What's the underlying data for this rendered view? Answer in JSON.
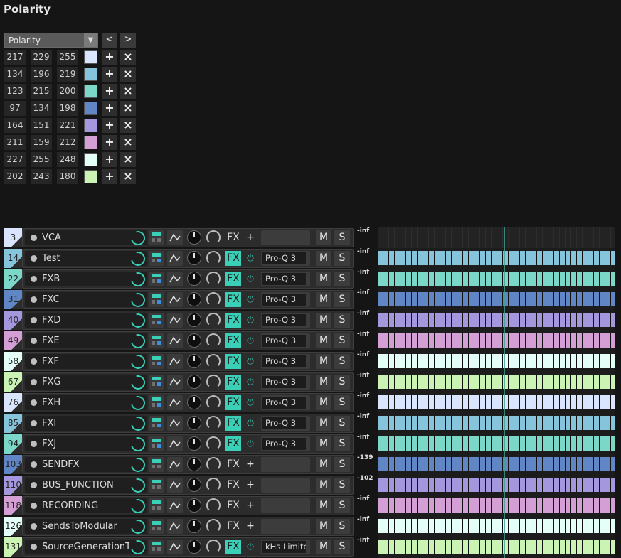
{
  "title": "Polarity",
  "palette": {
    "selected": "Polarity",
    "prev": "<",
    "next": ">",
    "add": "+",
    "remove": "×",
    "rows": [
      {
        "r": "217",
        "g": "229",
        "b": "255",
        "color": "#d9e5ff"
      },
      {
        "r": "134",
        "g": "196",
        "b": "219",
        "color": "#86c4db"
      },
      {
        "r": "123",
        "g": "215",
        "b": "200",
        "color": "#7bd7c8"
      },
      {
        "r": "97",
        "g": "134",
        "b": "198",
        "color": "#6186c6"
      },
      {
        "r": "164",
        "g": "151",
        "b": "221",
        "color": "#a497dd"
      },
      {
        "r": "211",
        "g": "159",
        "b": "212",
        "color": "#d39fd4"
      },
      {
        "r": "227",
        "g": "255",
        "b": "248",
        "color": "#e3fff8"
      },
      {
        "r": "202",
        "g": "243",
        "b": "180",
        "color": "#caf3b4"
      }
    ]
  },
  "tracks": [
    {
      "num": "3",
      "name": "VCA",
      "color": "#d9e5ff",
      "fx_on": false,
      "plugin": "",
      "route_blue": false,
      "meter": "-inf",
      "lane": false
    },
    {
      "num": "14",
      "name": "Test",
      "color": "#86c4db",
      "fx_on": true,
      "plugin": "Pro-Q 3",
      "route_blue": true,
      "meter": "-inf",
      "lane": true
    },
    {
      "num": "22",
      "name": "FXB",
      "color": "#7bd7c8",
      "fx_on": true,
      "plugin": "Pro-Q 3",
      "route_blue": true,
      "meter": "-inf",
      "lane": true
    },
    {
      "num": "31",
      "name": "FXC",
      "color": "#6186c6",
      "fx_on": true,
      "plugin": "Pro-Q 3",
      "route_blue": true,
      "meter": "-inf",
      "lane": true
    },
    {
      "num": "40",
      "name": "FXD",
      "color": "#a497dd",
      "fx_on": true,
      "plugin": "Pro-Q 3",
      "route_blue": true,
      "meter": "-inf",
      "lane": true
    },
    {
      "num": "49",
      "name": "FXE",
      "color": "#d39fd4",
      "fx_on": true,
      "plugin": "Pro-Q 3",
      "route_blue": true,
      "meter": "-inf",
      "lane": true
    },
    {
      "num": "58",
      "name": "FXF",
      "color": "#e3fff8",
      "fx_on": true,
      "plugin": "Pro-Q 3",
      "route_blue": true,
      "meter": "-inf",
      "lane": true
    },
    {
      "num": "67",
      "name": "FXG",
      "color": "#caf3b4",
      "fx_on": true,
      "plugin": "Pro-Q 3",
      "route_blue": true,
      "meter": "-inf",
      "lane": true
    },
    {
      "num": "76",
      "name": "FXH",
      "color": "#d9e5ff",
      "fx_on": true,
      "plugin": "Pro-Q 3",
      "route_blue": true,
      "meter": "-inf",
      "lane": true
    },
    {
      "num": "85",
      "name": "FXI",
      "color": "#86c4db",
      "fx_on": true,
      "plugin": "Pro-Q 3",
      "route_blue": true,
      "meter": "-inf",
      "lane": true
    },
    {
      "num": "94",
      "name": "FXJ",
      "color": "#7bd7c8",
      "fx_on": true,
      "plugin": "Pro-Q 3",
      "route_blue": true,
      "meter": "-inf",
      "lane": true
    },
    {
      "num": "103",
      "name": "SENDFX",
      "color": "#6186c6",
      "fx_on": false,
      "plugin": "",
      "route_blue": false,
      "meter": "-139",
      "lane": true
    },
    {
      "num": "110",
      "name": "BUS_FUNCTION",
      "color": "#a497dd",
      "fx_on": false,
      "plugin": "",
      "route_blue": false,
      "meter": "-102",
      "lane": true
    },
    {
      "num": "118",
      "name": "RECORDING",
      "color": "#d39fd4",
      "fx_on": false,
      "plugin": "",
      "route_blue": false,
      "meter": "-inf",
      "lane": true
    },
    {
      "num": "126",
      "name": "SendsToModular",
      "color": "#e3fff8",
      "fx_on": false,
      "plugin": "",
      "route_blue": false,
      "meter": "-inf",
      "lane": true
    },
    {
      "num": "131",
      "name": "SourceGenerationT",
      "color": "#caf3b4",
      "fx_on": true,
      "plugin": "kHs Limite",
      "route_blue": false,
      "meter": "-inf",
      "lane": true
    }
  ],
  "labels": {
    "fx": "FX",
    "plus": "+",
    "power": "⏻",
    "mute": "M",
    "solo": "S"
  }
}
